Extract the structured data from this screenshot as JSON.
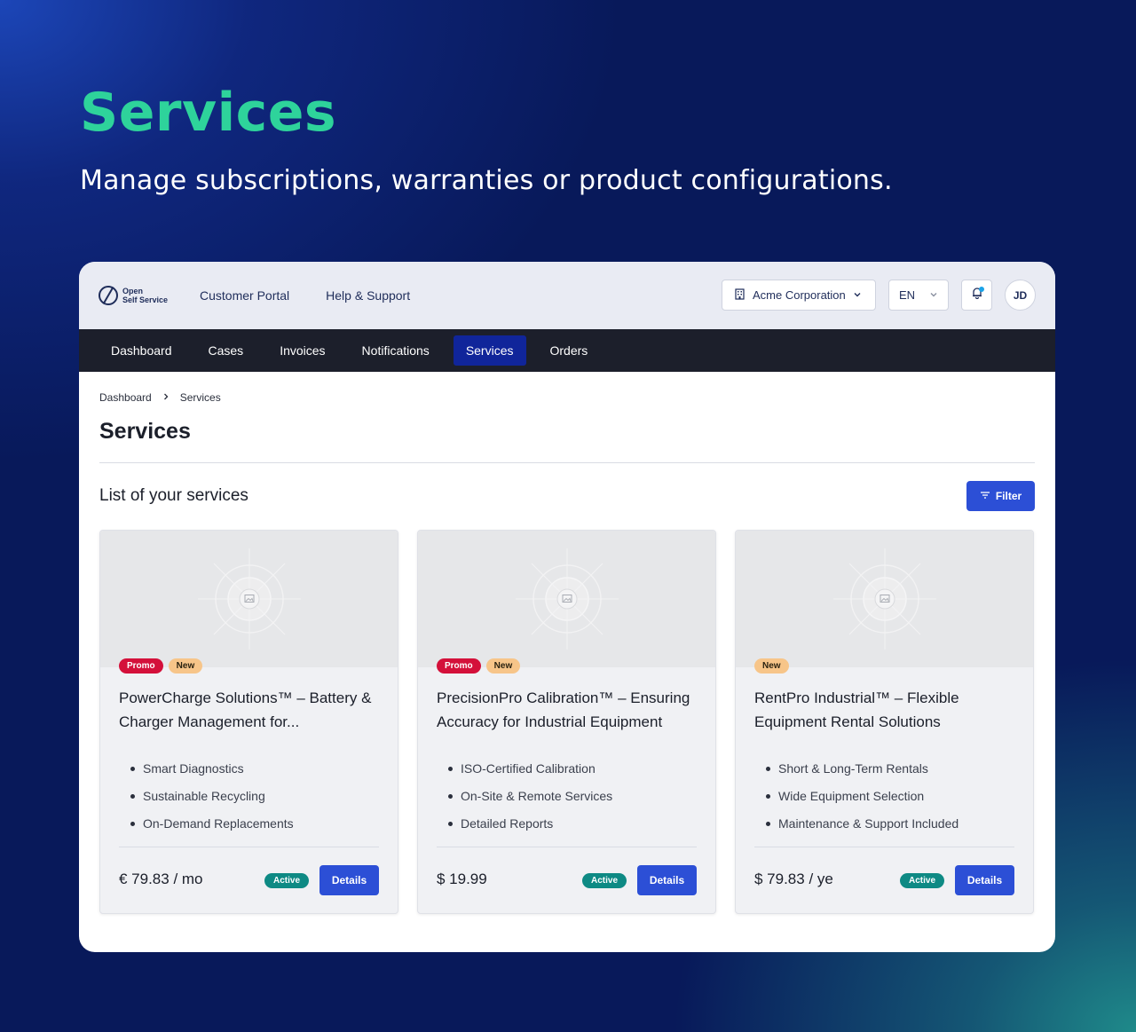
{
  "hero": {
    "title": "Services",
    "subtitle": "Manage subscriptions, warranties or product configurations."
  },
  "header": {
    "logo_line1": "Open",
    "logo_line2": "Self Service",
    "links": [
      "Customer Portal",
      "Help & Support"
    ],
    "organization": "Acme Corporation",
    "language": "EN",
    "avatar_initials": "JD"
  },
  "nav": {
    "items": [
      {
        "label": "Dashboard",
        "active": false
      },
      {
        "label": "Cases",
        "active": false
      },
      {
        "label": "Invoices",
        "active": false
      },
      {
        "label": "Notifications",
        "active": false
      },
      {
        "label": "Services",
        "active": true
      },
      {
        "label": "Orders",
        "active": false
      }
    ]
  },
  "breadcrumb": {
    "items": [
      "Dashboard",
      "Services"
    ]
  },
  "page": {
    "title": "Services",
    "list_title": "List of your services",
    "filter_label": "Filter"
  },
  "cards": [
    {
      "badges": [
        "Promo",
        "New"
      ],
      "title": "PowerCharge Solutions™ – Battery & Charger Management for...",
      "features": [
        "Smart Diagnostics",
        "Sustainable Recycling",
        "On-Demand Replacements"
      ],
      "price": "€ 79.83 / mo",
      "status": "Active",
      "button": "Details"
    },
    {
      "badges": [
        "Promo",
        "New"
      ],
      "title": "PrecisionPro Calibration™ – Ensuring Accuracy for Industrial Equipment",
      "features": [
        "ISO-Certified Calibration",
        "On-Site & Remote Services",
        "Detailed Reports"
      ],
      "price": "$ 19.99",
      "status": "Active",
      "button": "Details"
    },
    {
      "badges": [
        "New"
      ],
      "title": "RentPro Industrial™ – Flexible Equipment Rental Solutions",
      "features": [
        "Short & Long-Term Rentals",
        "Wide Equipment Selection",
        "Maintenance & Support Included"
      ],
      "price": "$ 79.83 / ye",
      "status": "Active",
      "button": "Details"
    }
  ],
  "colors": {
    "accent_green": "#2ed39b",
    "primary_blue": "#2c4fd6",
    "nav_dark": "#1c1f2b",
    "nav_active": "#10259a",
    "promo": "#d4103a",
    "new": "#f7c589",
    "active": "#0e8a84"
  },
  "icons": {
    "logo": "open-self-service-logo-icon",
    "organization": "building-icon",
    "chevron": "chevron-down-icon",
    "notifications": "bell-icon",
    "filter": "filter-icon",
    "breadcrumb_sep": "chevron-right-icon",
    "placeholder": "image-placeholder-icon"
  }
}
